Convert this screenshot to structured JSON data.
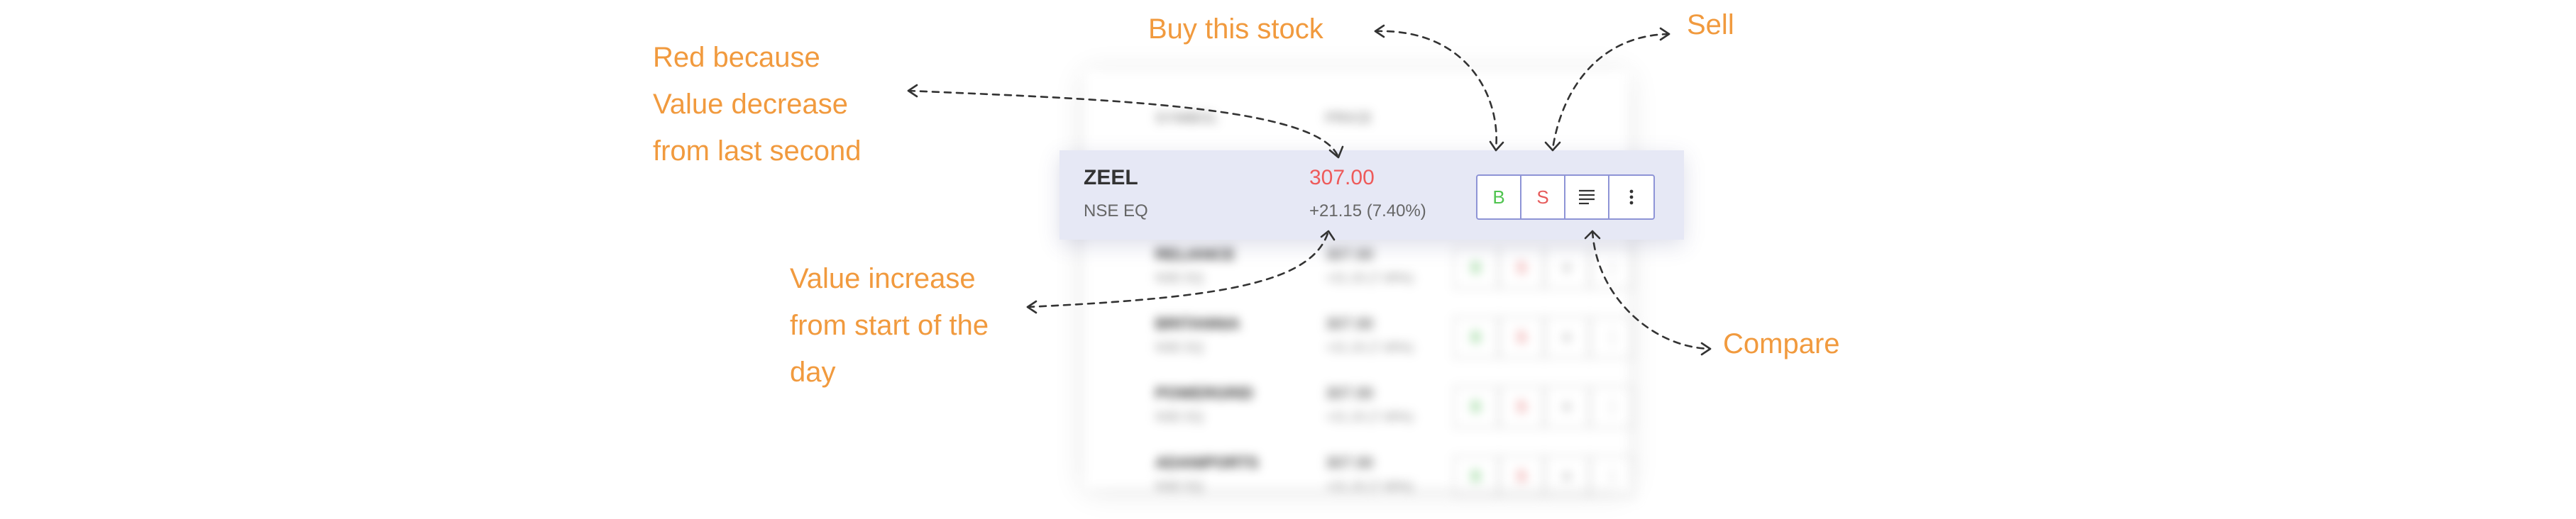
{
  "focus_row": {
    "symbol": "ZEEL",
    "exchange": "NSE EQ",
    "price": "307.00",
    "change": "+21.15 (7.40%)",
    "price_color": "#ee5a5a",
    "actions": {
      "buy_label": "B",
      "sell_label": "S",
      "compare_icon": "list-icon",
      "more_icon": "kebab-menu-icon"
    }
  },
  "background_list": {
    "header_symbol": "SYMBOL",
    "header_price": "PRICE",
    "rows": [
      {
        "symbol": "RELIANCE",
        "exchange": "NSE EQ",
        "price": "307.00",
        "change": "+21.15 (7.40%)"
      },
      {
        "symbol": "BRITANNIA",
        "exchange": "NSE EQ",
        "price": "307.00",
        "change": "+21.15 (7.40%)"
      },
      {
        "symbol": "POWERGRID",
        "exchange": "NSE EQ",
        "price": "307.00",
        "change": "+21.15 (7.40%)"
      },
      {
        "symbol": "ADANIPORTS",
        "exchange": "NSE EQ",
        "price": "307.00",
        "change": "+21.15 (7.40%)"
      }
    ]
  },
  "annotations": {
    "red_price": [
      "Red because",
      "Value decrease",
      "from last second"
    ],
    "value_increase": [
      "Value increase",
      "from start of the",
      "day"
    ],
    "buy": "Buy this stock",
    "sell": "Sell",
    "compare": "Compare",
    "color": "#f19a3e"
  }
}
